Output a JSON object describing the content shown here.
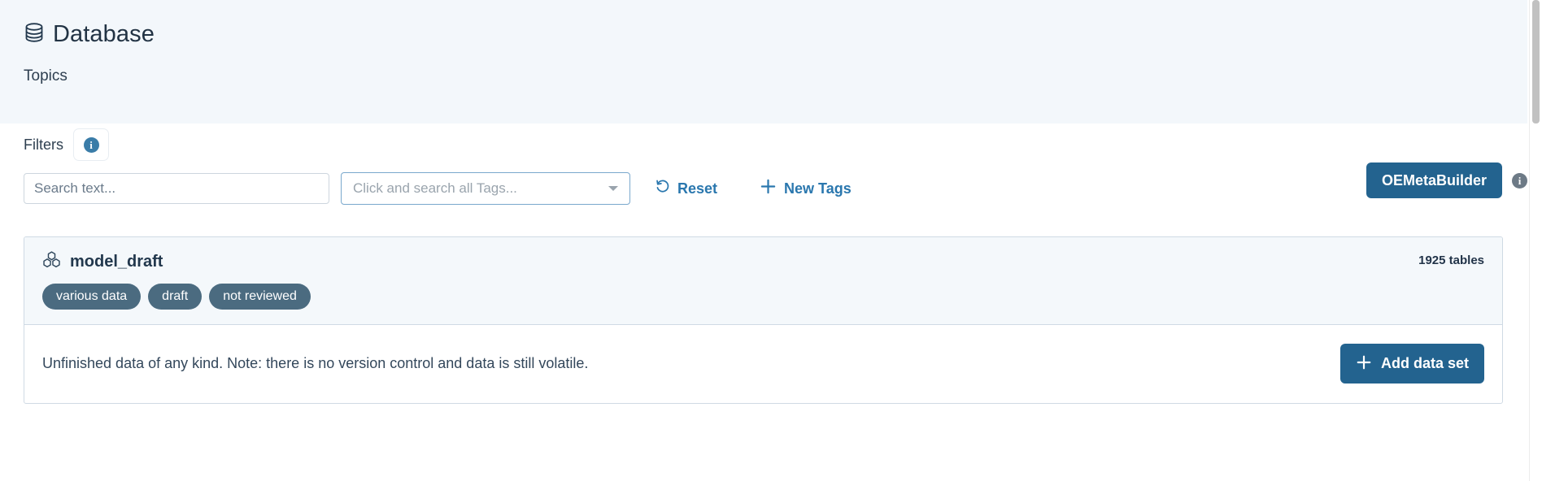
{
  "header": {
    "icon": "database-icon",
    "title": "Database",
    "subtitle": "Topics"
  },
  "filters": {
    "label": "Filters",
    "info_icon": "info-icon",
    "search": {
      "value": "",
      "placeholder": "Search text..."
    },
    "tag_select": {
      "placeholder": "Click and search all Tags...",
      "caret_icon": "chevron-down-icon"
    },
    "reset_button": {
      "label": "Reset",
      "icon": "undo-arrow-icon"
    },
    "new_tags_button": {
      "label": "New Tags",
      "icon": "plus-icon"
    },
    "oemetabuilder_button": {
      "label": "OEMetaBuilder"
    },
    "oemetabuilder_info_icon": "info-icon"
  },
  "dataset_card": {
    "icon": "boxes-icon",
    "title": "model_draft",
    "table_count": "1925 tables",
    "tags": [
      {
        "label": "various data"
      },
      {
        "label": "draft"
      },
      {
        "label": "not reviewed"
      }
    ],
    "description": "Unfinished data of any kind. Note: there is no version control and data is still volatile.",
    "add_button": {
      "label": "Add data set",
      "icon": "plus-icon"
    }
  },
  "colors": {
    "header_band": "#f3f7fb",
    "primary_button": "#23638f",
    "link_blue": "#2a77ae",
    "tag_pill": "#4b6b80",
    "card_header": "#f4f8fb",
    "card_border": "#cfdae4"
  }
}
